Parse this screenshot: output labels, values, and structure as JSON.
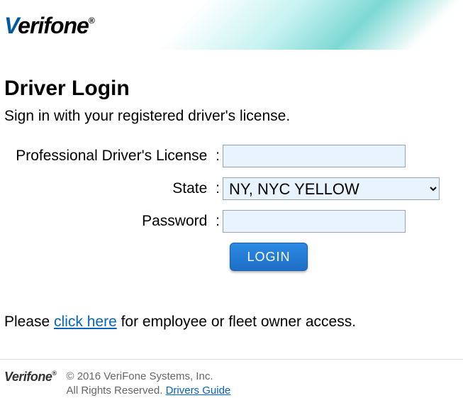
{
  "brand": "Verifone",
  "page": {
    "title": "Driver Login",
    "subtitle": "Sign in with your registered driver's license."
  },
  "form": {
    "license_label": "Professional Driver's License",
    "license_value": "",
    "state_label": "State",
    "state_selected": "NY, NYC YELLOW",
    "password_label": "Password",
    "password_value": "",
    "login_button": "LOGIN"
  },
  "alt_access": {
    "prefix": "Please ",
    "link_text": "click here",
    "suffix": " for employee or fleet owner access."
  },
  "footer": {
    "copyright": "© 2016 VeriFone Systems, Inc.",
    "rights": "All Rights Reserved. ",
    "guide_link": "Drivers Guide"
  }
}
